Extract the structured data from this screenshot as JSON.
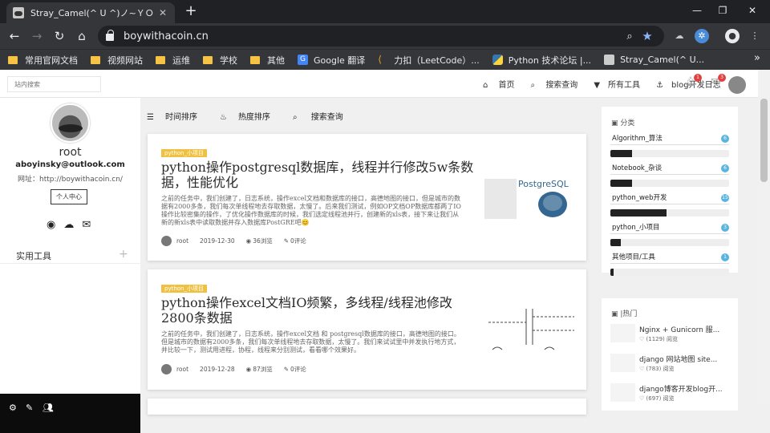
{
  "browser": {
    "tab_title": "Stray_Camel(^ U ^)ノ~ＹＯ",
    "tab_close": "✕",
    "new_tab": "+",
    "url": "boywithacoin.cn",
    "bookmarks": [
      {
        "label": "常用官网文档",
        "icon": "folder-icon"
      },
      {
        "label": "视频网站",
        "icon": "folder-icon"
      },
      {
        "label": "运维",
        "icon": "folder-icon"
      },
      {
        "label": "学校",
        "icon": "folder-icon"
      },
      {
        "label": "其他",
        "icon": "folder-icon"
      },
      {
        "label": "Google 翻译",
        "icon": "google-translate-icon"
      },
      {
        "label": "力扣（LeetCode）...",
        "icon": "leetcode-icon"
      },
      {
        "label": "Python 技术论坛 |...",
        "icon": "python-icon"
      },
      {
        "label": "Stray_Camel(^ U...",
        "icon": "site-icon"
      }
    ],
    "bookmarks_more": "»"
  },
  "topnav": {
    "search_placeholder": "站内搜索",
    "links": [
      "首页",
      "搜索查询",
      "所有工具",
      "blog开发日志"
    ],
    "notify_count": "1",
    "mail_count": "3"
  },
  "sidebar": {
    "username": "root",
    "email": "aboyinsky@outlook.com",
    "website": "网址：http://boywithacoin.cn/",
    "center_button": "个人中心",
    "tools_label": "实用工具",
    "tools_plus": "+"
  },
  "sortbar": {
    "time": "时间排序",
    "hot": "热度排序",
    "search": "搜索查询"
  },
  "articles": [
    {
      "tag": "python_小项目",
      "title": "python操作postgresql数据库，线程并行修改5w条数据，性能优化",
      "excerpt": "之前的任务中，我们创建了，日志系统，操作excel文档和数据库的接口，高德地图的接口，但是城市的数据有2000多条，我们每次单线程地去存取数据，太慢了。后来我们测试，例如OP文档OP数据库都两了IO操作比较密集的操作，了优化操作数据库的时候，我们选定线程池并行，创建新的xls表，接下来让我们从新的新xls表中读取数据并存入数据库PostGRE吧😊",
      "author": "root",
      "date": "2019-12-30",
      "views": "36浏览",
      "comments": "0评论"
    },
    {
      "tag": "python_小项目",
      "title": "python操作excel文档IO频繁，多线程/线程池修改2800条数据",
      "excerpt": "之前的任务中，我们创建了，日志系统，操作excel文档 和 postgresql数据库的接口，高德地图的接口。但是城市的数据有2000多条，我们每次单线程地去存取数据，太慢了。我们来试试里中并发执行地方式，并比较一下，测试用进程，协程，线程来分别测试，看看哪个效果好。",
      "author": "root",
      "date": "2019-12-28",
      "views": "87浏览",
      "comments": "0评论"
    }
  ],
  "categories": {
    "title": "分类",
    "items": [
      {
        "name": "Algorithm_算法",
        "count": "6",
        "fill": 0.18
      },
      {
        "name": "Notebook_杂谈",
        "count": "6",
        "fill": 0.18
      },
      {
        "name": "python_web开发",
        "count": "15",
        "fill": 0.47
      },
      {
        "name": "python_小项目",
        "count": "3",
        "fill": 0.09
      },
      {
        "name": "其他项目/工具",
        "count": "1",
        "fill": 0.03
      }
    ]
  },
  "hot": {
    "title": "热门",
    "items": [
      {
        "title": "Nginx + Gunicorn 服...",
        "views": "(1129) 阅览"
      },
      {
        "title": "django 网站地图 site...",
        "views": "(783) 阅览"
      },
      {
        "title": "django博客开发blog开...",
        "views": "(697) 阅览"
      }
    ]
  },
  "colors": {
    "tag": "#f0c040",
    "badge": "#e04040",
    "category_count": "#5ab4e0",
    "browser_dark": "#35363a"
  }
}
